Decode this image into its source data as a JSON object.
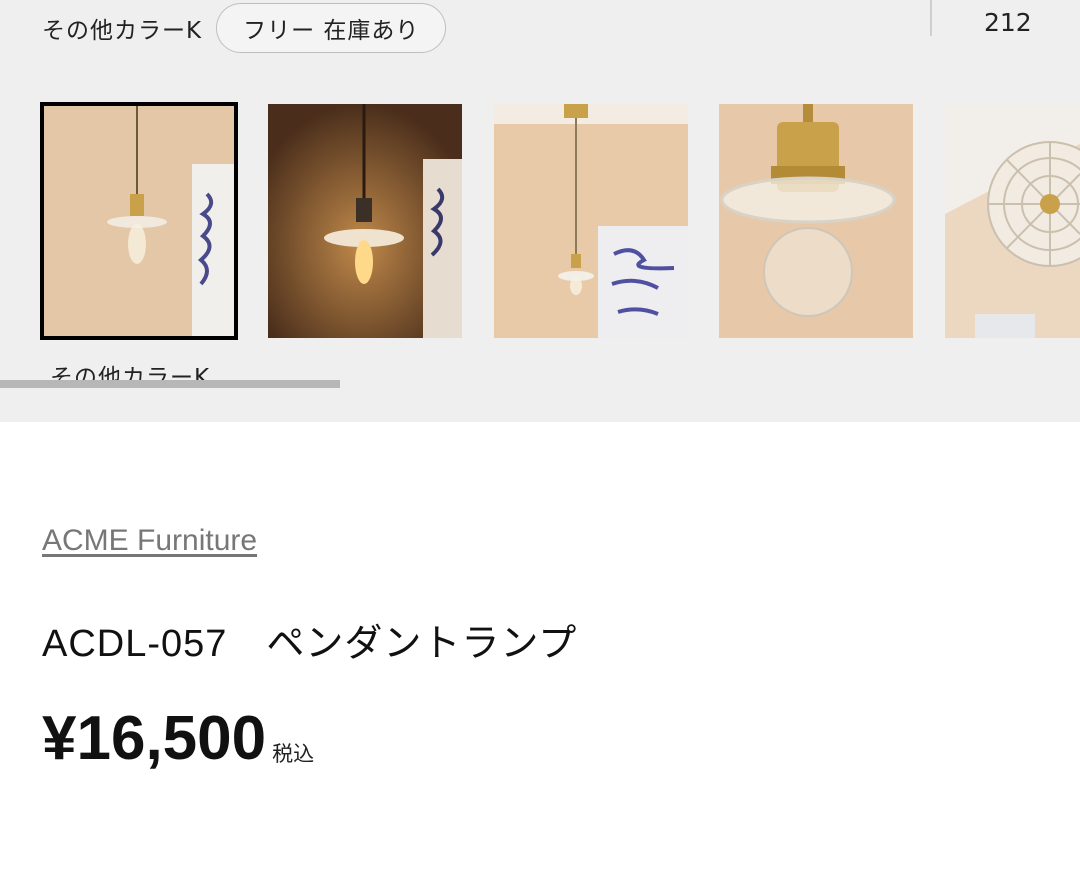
{
  "variant": {
    "color_label": "その他カラーK",
    "stock_label": "フリー 在庫あり",
    "count": "212"
  },
  "gallery": {
    "selected_caption": "その他カラーK",
    "thumbnails": [
      {
        "name": "pendant-lamp-photo-1",
        "selected": true
      },
      {
        "name": "pendant-lamp-photo-2",
        "selected": false
      },
      {
        "name": "pendant-lamp-photo-3",
        "selected": false
      },
      {
        "name": "pendant-lamp-photo-4",
        "selected": false
      },
      {
        "name": "pendant-lamp-photo-5",
        "selected": false
      }
    ]
  },
  "product": {
    "brand": "ACME Furniture",
    "title": "ACDL-057　ペンダントランプ",
    "price": "¥16,500",
    "tax_note": "税込"
  },
  "colors": {
    "panel_bg": "#efefef",
    "wall_beige": "#e8c9a8",
    "brass": "#c9a14a",
    "selected_border": "#000000",
    "brand_link": "#777777"
  }
}
